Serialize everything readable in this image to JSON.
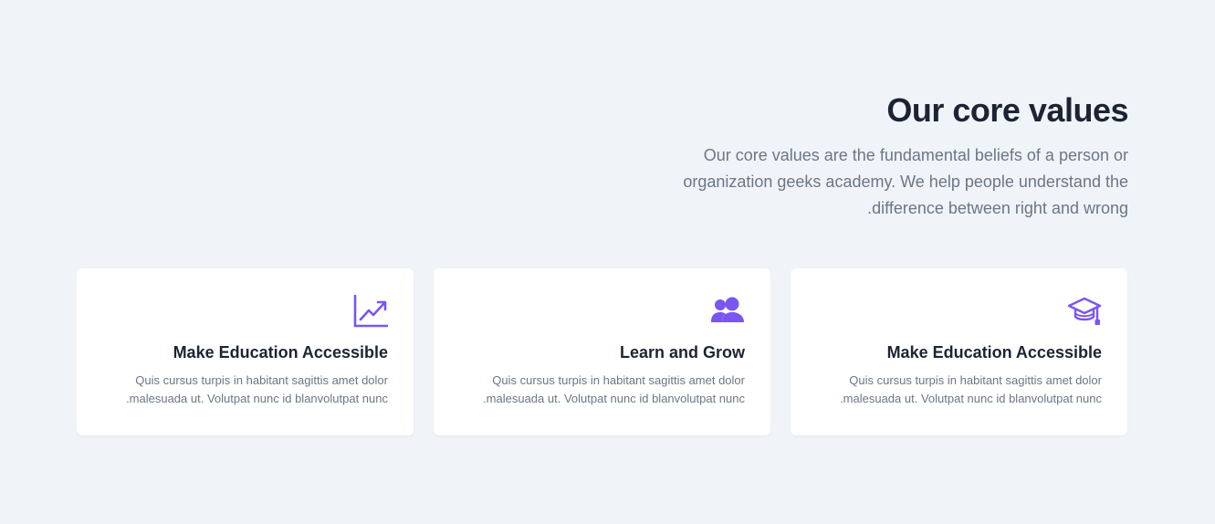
{
  "header": {
    "title": "Our core values",
    "description_lines": [
      "Our core values are the fundamental beliefs of a person or",
      "organization geeks academy. We help people understand the",
      ".difference between right and wrong"
    ]
  },
  "cards": [
    {
      "icon": "chart-line-icon",
      "title": "Make Education Accessible",
      "text_lines": [
        "Quis cursus turpis in habitant sagittis amet dolor",
        ".malesuada ut. Volutpat nunc id blanvolutpat nunc"
      ]
    },
    {
      "icon": "users-icon",
      "title": "Learn and Grow",
      "text_lines": [
        "Quis cursus turpis in habitant sagittis amet dolor",
        ".malesuada ut. Volutpat nunc id blanvolutpat nunc"
      ]
    },
    {
      "icon": "graduation-cap-icon",
      "title": "Make Education Accessible",
      "text_lines": [
        "Quis cursus turpis in habitant sagittis amet dolor",
        ".malesuada ut. Volutpat nunc id blanvolutpat nunc"
      ]
    }
  ],
  "colors": {
    "background": "#f0f4f9",
    "card_background": "#ffffff",
    "accent": "#7a55f0",
    "heading": "#1c2434",
    "body_text": "#6b7686"
  }
}
